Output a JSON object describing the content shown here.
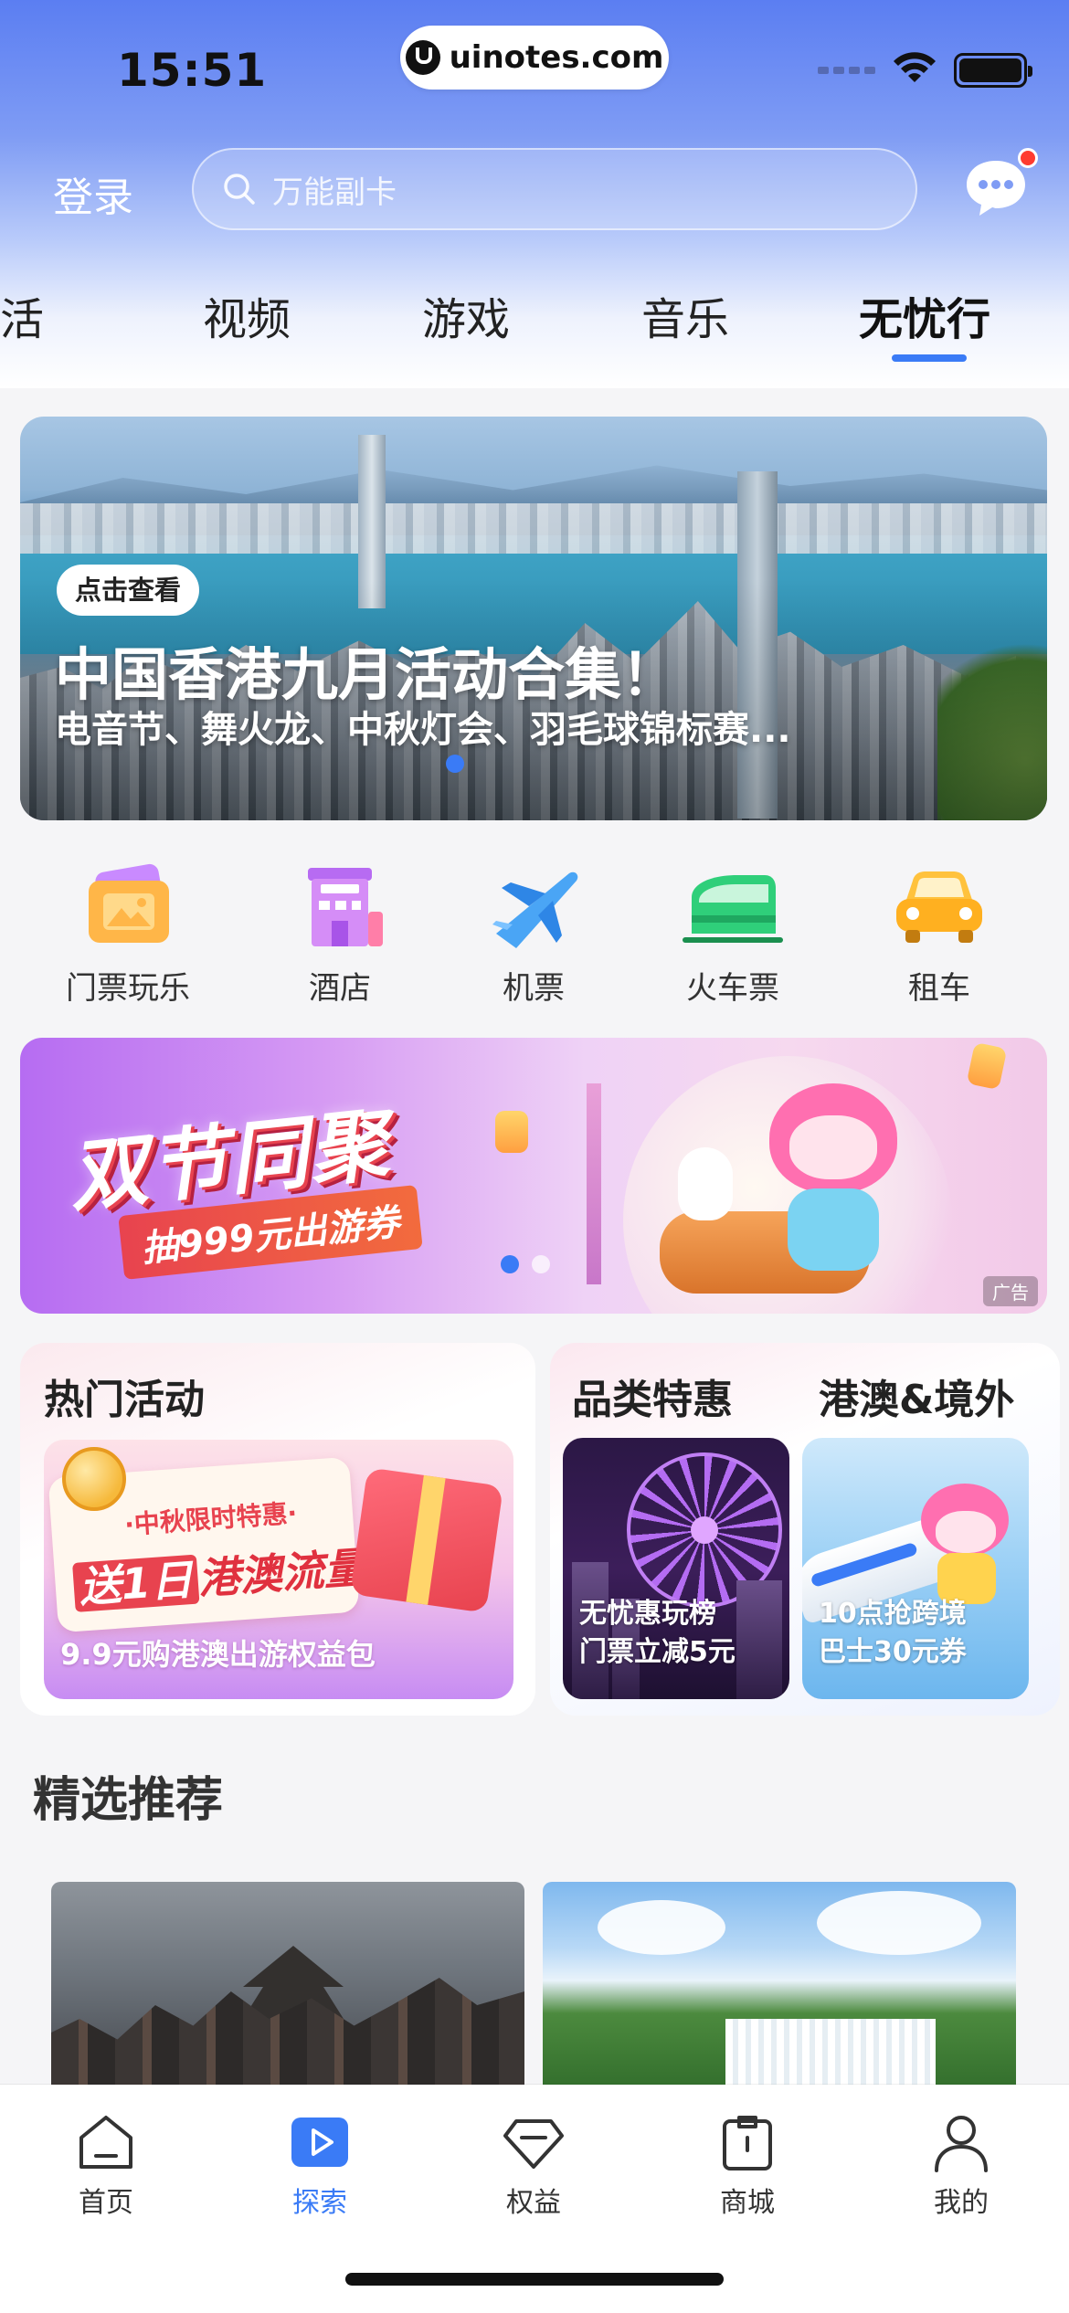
{
  "status_bar": {
    "time": "15:51",
    "url": "uinotes.com"
  },
  "header": {
    "login_label": "登录",
    "search": {
      "placeholder": "万能副卡"
    },
    "tabs": [
      {
        "label": "生活"
      },
      {
        "label": "视频"
      },
      {
        "label": "游戏"
      },
      {
        "label": "音乐"
      },
      {
        "label": "无忧行",
        "active": true
      }
    ]
  },
  "hero_banner": {
    "badge": "点击查看",
    "title": "中国香港九月活动合集！",
    "subtitle": "电音节、舞火龙、中秋灯会、羽毛球锦标赛..."
  },
  "categories": [
    {
      "label": "门票玩乐",
      "icon": "ticket-icon"
    },
    {
      "label": "酒店",
      "icon": "hotel-icon"
    },
    {
      "label": "机票",
      "icon": "airplane-icon"
    },
    {
      "label": "火车票",
      "icon": "train-icon"
    },
    {
      "label": "租车",
      "icon": "car-icon"
    }
  ],
  "promo_banner": {
    "title": "双节同聚",
    "sub_prefix": "抽",
    "sub_amount": "999元",
    "sub_suffix": "出游券",
    "ad_tag": "广告"
  },
  "hot_activity": {
    "title": "热门活动",
    "scroll_top": "·中秋限时特惠·",
    "scroll_main_hl": "送1日",
    "scroll_main_rest": "港澳流量",
    "caption": "9.9元购港澳出游权益包"
  },
  "deals": {
    "title_left": "品类特惠",
    "title_right": "港澳&境外",
    "card1": {
      "line1": "无忧惠玩榜",
      "line2": "门票立减5元"
    },
    "card2": {
      "line1": "10点抢跨境",
      "line2": "巴士30元券"
    }
  },
  "recommend": {
    "title": "精选推荐"
  },
  "tabbar": [
    {
      "label": "首页",
      "icon": "home-icon"
    },
    {
      "label": "探索",
      "icon": "explore-play-icon",
      "active": true
    },
    {
      "label": "权益",
      "icon": "diamond-icon"
    },
    {
      "label": "商城",
      "icon": "shopping-bag-icon"
    },
    {
      "label": "我的",
      "icon": "user-icon"
    }
  ],
  "colors": {
    "accent": "#3a7bf6",
    "badge_red": "#ff3b30"
  }
}
